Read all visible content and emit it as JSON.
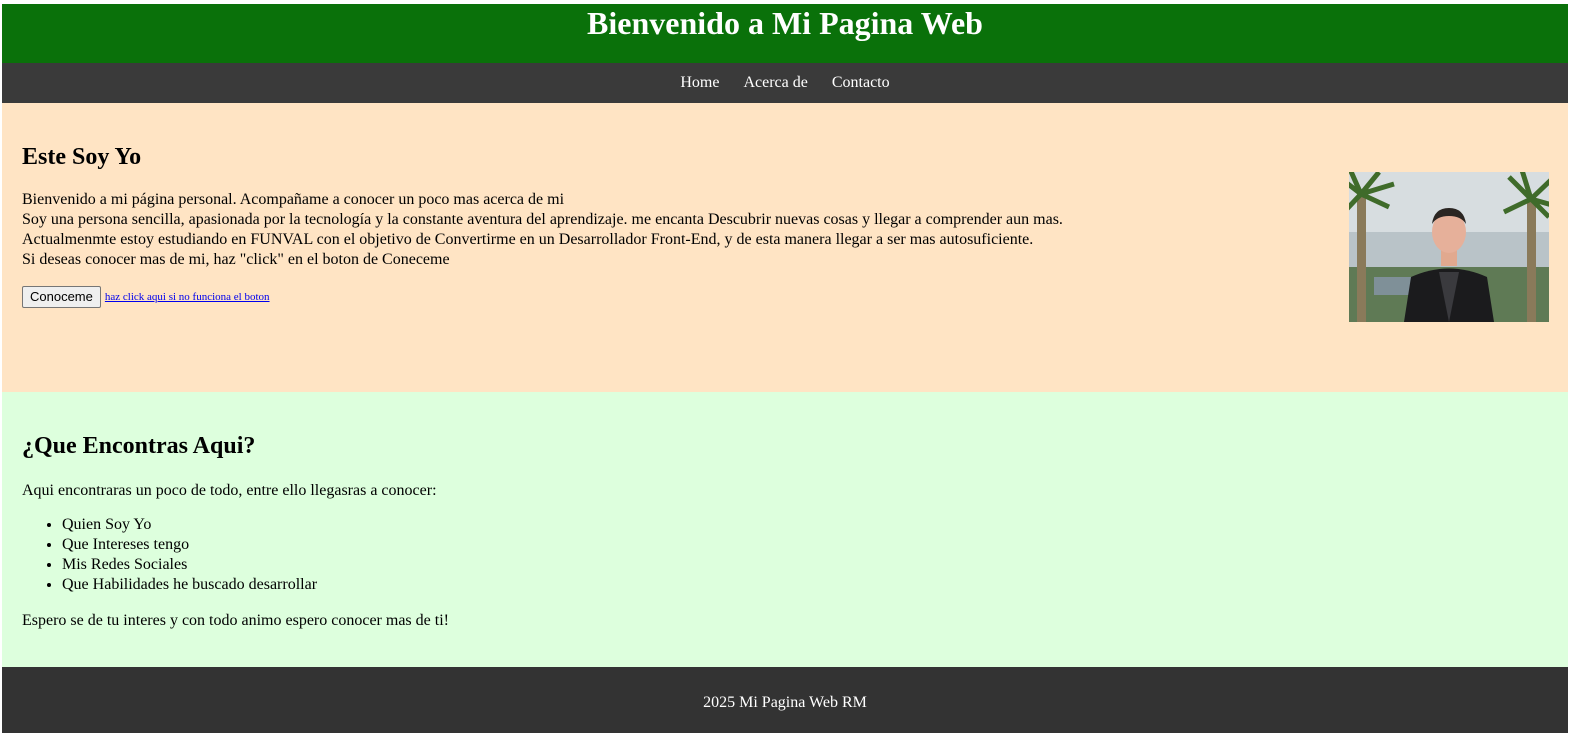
{
  "header": {
    "title": "Bienvenido a Mi Pagina Web"
  },
  "nav": {
    "items": [
      "Home",
      "Acerca de",
      "Contacto"
    ]
  },
  "hero": {
    "title": "Este Soy Yo",
    "paragraph_lines": [
      "Bienvenido a mi página personal. Acompañame a conocer un poco mas acerca de mi",
      "Soy una persona sencilla, apasionada por la tecnología y la constante aventura del aprendizaje. me encanta Descubrir nuevas cosas y llegar a comprender aun mas.",
      "Actualmenmte estoy estudiando en FUNVAL con el objetivo de Convertirme en un Desarrollador Front-End, y de esta manera llegar a ser mas autosuficiente.",
      "Si deseas conocer mas de mi, haz \"click\" en el boton de Coneceme"
    ],
    "button_label": "Conoceme",
    "fallback_link": "haz click aqui si no funciona el boton"
  },
  "features": {
    "title": "¿Que Encontras Aqui?",
    "intro": "Aqui encontraras un poco de todo, entre ello llegasras a conocer:",
    "items": [
      "Quien Soy Yo",
      "Que Intereses tengo",
      "Mis Redes Sociales",
      "Que Habilidades he buscado desarrollar"
    ],
    "outro": "Espero se de tu interes y con todo animo espero conocer mas de ti!"
  },
  "footer": {
    "text": "2025 Mi Pagina Web RM"
  },
  "colors": {
    "header_bg": "#0a710a",
    "nav_bg": "#3a3a3a",
    "hero_bg": "#ffe4c4",
    "features_bg": "#ddffdd",
    "footer_bg": "#333333"
  }
}
